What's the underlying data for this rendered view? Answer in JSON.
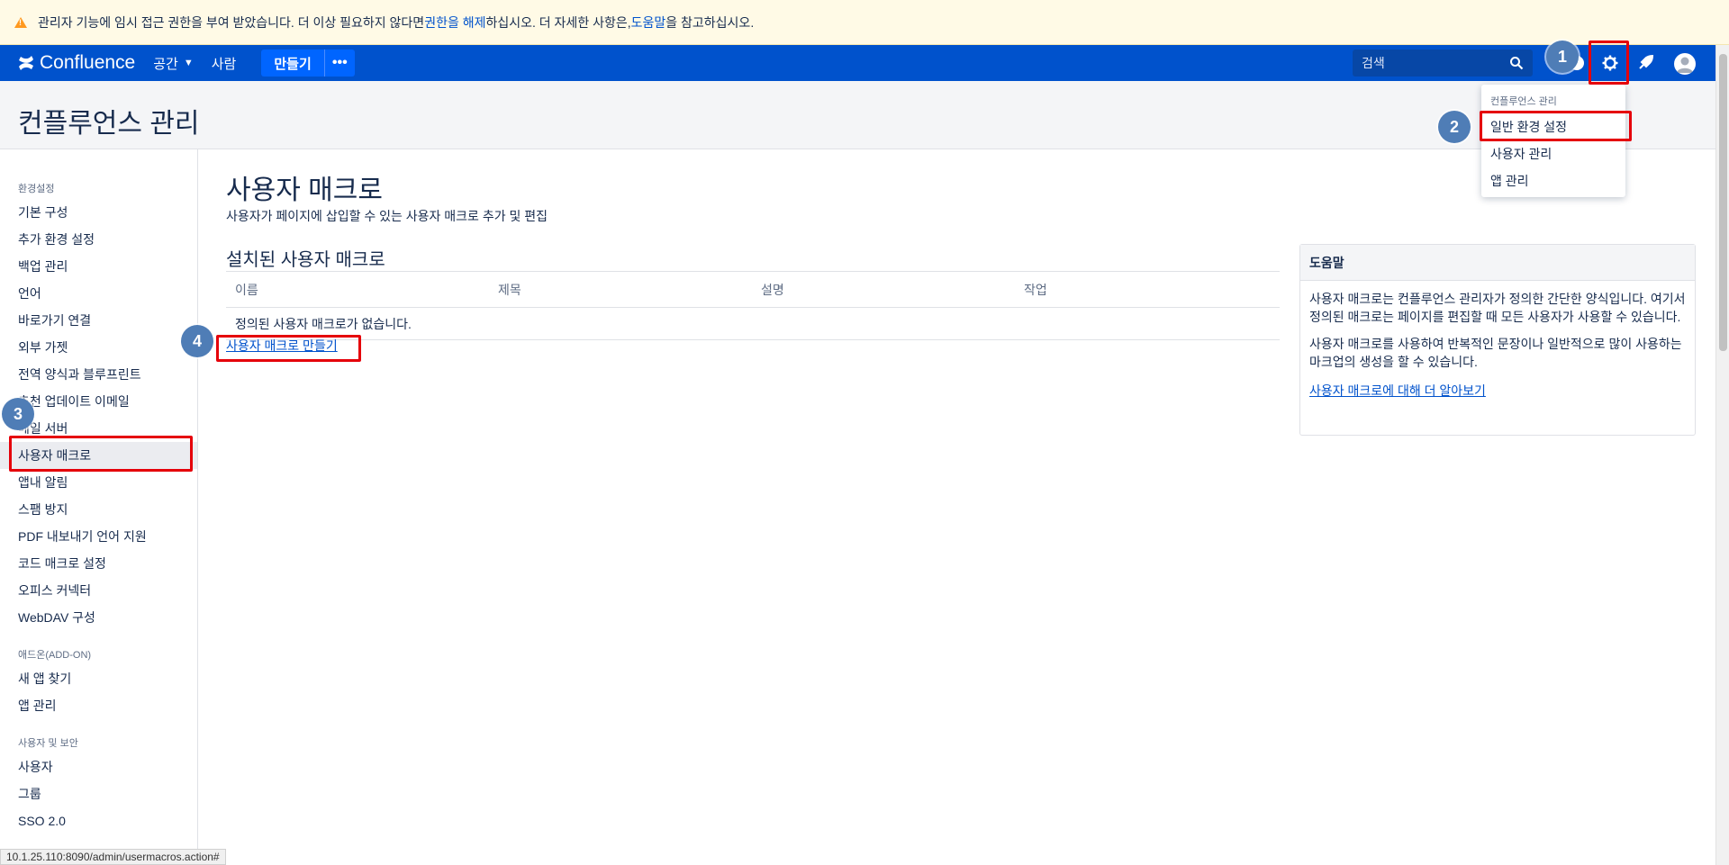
{
  "banner": {
    "text_before": "관리자 기능에 임시 접근 권한을 부여 받았습니다. 더 이상 필요하지 않다면 ",
    "link_release": "권한을 해제",
    "text_mid": "하십시오. 더 자세한 사항은, ",
    "link_help": "도움말",
    "text_after": "을 참고하십시오."
  },
  "navbar": {
    "brand": "Confluence",
    "spaces": "공간",
    "people": "사람",
    "create": "만들기",
    "more": "•••",
    "search_placeholder": "검색"
  },
  "header": {
    "title": "컨플루언스 관리"
  },
  "sidebar": {
    "sections": [
      {
        "title": "환경설정",
        "items": [
          "기본 구성",
          "추가 환경 설정",
          "백업 관리",
          "언어",
          "바로가기 연결",
          "외부 가젯",
          "전역 양식과 블루프린트",
          "추천 업데이트 이메일",
          "메일 서버",
          "사용자 매크로",
          "앱내 알림",
          "스팸 방지",
          "PDF 내보내기 언어 지원",
          "코드 매크로 설정",
          "오피스 커넥터",
          "WebDAV 구성"
        ]
      },
      {
        "title": "애드온(ADD-ON)",
        "items": [
          "새 앱 찾기",
          "앱 관리"
        ]
      },
      {
        "title": "사용자 및 보안",
        "items": [
          "사용자",
          "그룹",
          "SSO 2.0"
        ]
      }
    ]
  },
  "main": {
    "title": "사용자 매크로",
    "description": "사용자가 페이지에 삽입할 수 있는 사용자 매크로 추가 및 편집",
    "installed_title": "설치된 사용자 매크로",
    "columns": [
      "이름",
      "제목",
      "설명",
      "작업"
    ],
    "empty": "정의된 사용자 매크로가 없습니다.",
    "create_link": "사용자 매크로 만들기"
  },
  "help": {
    "title": "도움말",
    "p1": "사용자 매크로는 컨플루언스 관리자가 정의한 간단한 양식입니다. 여기서 정의된 매크로는 페이지를 편집할 때 모든 사용자가 사용할 수 있습니다.",
    "p2": "사용자 매크로를 사용하여 반복적인 문장이나 일반적으로 많이 사용하는 마크업의 생성을 할 수 있습니다.",
    "link": "사용자 매크로에 대해 더 알아보기"
  },
  "dropdown": {
    "heading": "컨플루언스 관리",
    "items": [
      "일반 환경 설정",
      "사용자 관리",
      "앱 관리"
    ]
  },
  "badges": [
    "1",
    "2",
    "3",
    "4"
  ],
  "status_url": "10.1.25.110:8090/admin/usermacros.action#",
  "colors": {
    "brand": "#0052cc",
    "annotation_red": "#e5000a",
    "badge": "#4f7db6"
  }
}
